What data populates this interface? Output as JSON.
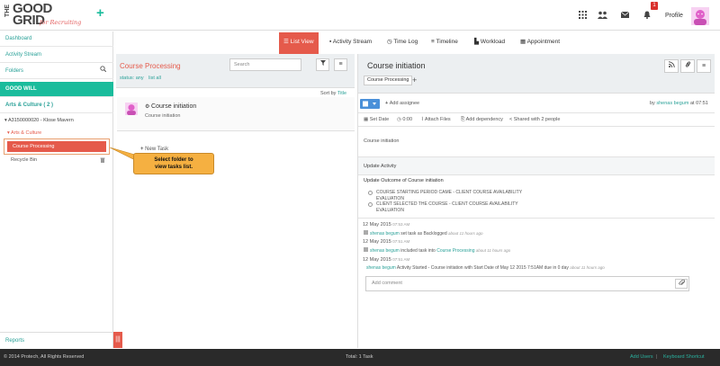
{
  "header": {
    "logo_the": "THE",
    "logo_good": "GOOD",
    "logo_grid": "GRID",
    "logo_tag": "for Recruiting",
    "add_icon": "plus-icon",
    "notification_count": "1",
    "profile_label": "Profile",
    "icons": [
      "grid-icon",
      "users-icon",
      "envelope-icon",
      "bell-icon"
    ]
  },
  "sidebar": {
    "dashboard": "Dashboard",
    "activity_stream": "Activity Stream",
    "folders": "Folders",
    "good_will": "GOOD WILL",
    "arts_culture": "Arts & Culture  ( 2 )",
    "tree_item": "▾ A3150000020 - Klose Mavern",
    "tree_sub": "▾ Arts & Culture",
    "selected": "Course Processing",
    "recycle": "Recycle Bin",
    "reports": "Reports"
  },
  "tooltip": {
    "line1": "Select folder to",
    "line2": "view tasks list."
  },
  "tabs": [
    {
      "label": "List View",
      "icon": "list-icon"
    },
    {
      "label": "Activity Stream",
      "icon": "comment-icon"
    },
    {
      "label": "Time Log",
      "icon": "clock-icon"
    },
    {
      "label": "Timeline",
      "icon": "timeline-icon"
    },
    {
      "label": "Workload",
      "icon": "workload-icon"
    },
    {
      "label": "Appointment",
      "icon": "calendar-icon"
    }
  ],
  "middle": {
    "title": "Course Processing",
    "status_label": "status: any",
    "list_all": "list all",
    "search_placeholder": "Search",
    "sort_prefix": "Sort by ",
    "sort_field": "Title",
    "task_title": "Course initiation",
    "task_sub": "Course initiation",
    "new_task": "New Task"
  },
  "detail": {
    "title": "Course initiation",
    "chip": "Course Processing",
    "add_assignee": "Add assignee",
    "by_prefix": "by ",
    "by_user": "shenas begum",
    "by_time": " at 07:51",
    "set_date": "Set Date",
    "time": "0:00",
    "attach": "Attach Files",
    "dependency": "Add dependency",
    "shared": "Shared with 2 people",
    "description": "Course initiation",
    "update_activity": "Update Activity",
    "update_outcome": "Update Outcome of Course initiation",
    "option1a": "COURSE STARTING PERIOD CAME - CLIENT COURSE AVAILABILITY",
    "option1b": "EVALUATION",
    "option2a": "CLIENT SELECTED THE COURSE - CLIENT COURSE AVAILABILITY",
    "option2b": "EVALUATION",
    "activities": [
      {
        "date": "12 May 2015",
        "time": "07:53 AM",
        "user": "shenas begum",
        "text": " set task as Backlogged ",
        "ago": "about 11 hours ago"
      },
      {
        "date": "12 May 2015",
        "time": "07:51 AM",
        "user": "shenas begum",
        "text": " included task into ",
        "link": "Course Processing",
        "ago": " about 11 hours ago"
      },
      {
        "date": "12 May 2015",
        "time": "07:51 AM",
        "user": "shenas begum",
        "text": " Activity Started - Course initiation with Start Date of May 12 2015 7:51AM due in 0 day ",
        "ago": "about 11 hours ago"
      }
    ],
    "comment_placeholder": "Add comment"
  },
  "footer": {
    "copyright": "© 2014 Protech, All Rights Reserved",
    "total": "Total: 1 Task",
    "add_users": "Add Users",
    "separator": "|",
    "keyboard": "Keyboard Shortcut"
  },
  "colors": {
    "accent": "#e55a4b",
    "teal": "#1abc9c",
    "link": "#2aa198",
    "footer": "#2a2a2a"
  }
}
